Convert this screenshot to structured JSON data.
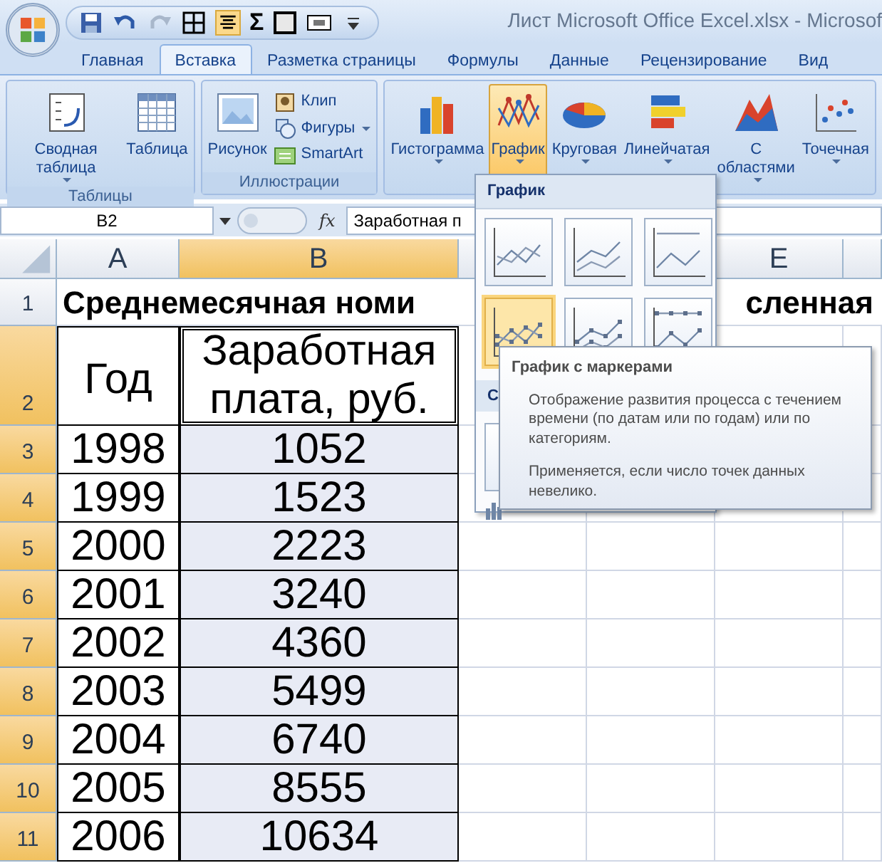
{
  "title_bar": {
    "title": "Лист Microsoft Office Excel.xlsx - Microsof",
    "sum_symbol": "Σ"
  },
  "tabs": [
    {
      "label": "Главная",
      "selected": false
    },
    {
      "label": "Вставка",
      "selected": true
    },
    {
      "label": "Разметка страницы",
      "selected": false
    },
    {
      "label": "Формулы",
      "selected": false
    },
    {
      "label": "Данные",
      "selected": false
    },
    {
      "label": "Рецензирование",
      "selected": false
    },
    {
      "label": "Вид",
      "selected": false
    }
  ],
  "ribbon": {
    "groups": [
      {
        "label": "Таблицы",
        "large": [
          {
            "kind": "pivot",
            "label": "Сводная таблица",
            "dropdown": true,
            "selected": false
          },
          {
            "kind": "table",
            "label": "Таблица",
            "dropdown": false,
            "selected": false
          }
        ]
      },
      {
        "label": "Иллюстрации",
        "large": [
          {
            "kind": "picture",
            "label": "Рисунок",
            "dropdown": false,
            "selected": false
          }
        ],
        "small": [
          {
            "kind": "clip",
            "label": "Клип",
            "dropdown": false
          },
          {
            "kind": "shapes",
            "label": "Фигуры",
            "dropdown": true
          },
          {
            "kind": "smartart",
            "label": "SmartArt",
            "dropdown": false
          }
        ]
      },
      {
        "large": [
          {
            "kind": "column",
            "label": "Гистограмма",
            "dropdown": true,
            "selected": false
          },
          {
            "kind": "line",
            "label": "График",
            "dropdown": true,
            "selected": true
          },
          {
            "kind": "pie",
            "label": "Круговая",
            "dropdown": true,
            "selected": false
          },
          {
            "kind": "bar",
            "label": "Линейчатая",
            "dropdown": true,
            "selected": false
          },
          {
            "kind": "area",
            "label": "С областями",
            "dropdown": true,
            "selected": false
          },
          {
            "kind": "scatter",
            "label": "Точечная",
            "dropdown": true,
            "selected": false
          }
        ]
      }
    ]
  },
  "formula_bar": {
    "name_box": "B2",
    "fx": "fx",
    "content": "Заработная п"
  },
  "columns": [
    {
      "label": "A",
      "selected": false
    },
    {
      "label": "B",
      "selected": true
    },
    {
      "selected": false
    },
    {},
    {
      "label": "E",
      "selected": false
    }
  ],
  "sheet": {
    "title_row": {
      "number": "1",
      "selected": false,
      "texts": [
        "Среднемесячная номи",
        "сленная"
      ]
    },
    "header_row": {
      "number": "2",
      "selected": true,
      "year": "Год",
      "wage": "Заработная плата, руб."
    },
    "rows": [
      {
        "number": "3",
        "selected": true,
        "year": "1998",
        "wage": "1052"
      },
      {
        "number": "4",
        "selected": true,
        "year": "1999",
        "wage": "1523"
      },
      {
        "number": "5",
        "selected": true,
        "year": "2000",
        "wage": "2223"
      },
      {
        "number": "6",
        "selected": true,
        "year": "2001",
        "wage": "3240"
      },
      {
        "number": "7",
        "selected": true,
        "year": "2002",
        "wage": "4360"
      },
      {
        "number": "8",
        "selected": true,
        "year": "2003",
        "wage": "5499"
      },
      {
        "number": "9",
        "selected": true,
        "year": "2004",
        "wage": "6740"
      },
      {
        "number": "10",
        "selected": true,
        "year": "2005",
        "wage": "8555"
      },
      {
        "number": "11",
        "selected": true,
        "year": "2006",
        "wage": "10634"
      }
    ]
  },
  "chart_menu": {
    "header": "График",
    "section_label": "С",
    "thumbnails": [
      {
        "selected": false
      },
      {
        "selected": false
      },
      {
        "selected": false
      },
      {
        "selected": true
      },
      {
        "selected": false
      },
      {
        "selected": false
      },
      {
        "selected": false
      }
    ],
    "tooltip": {
      "title": "График с маркерами",
      "paragraphs": [
        "Отображение развития процесса с течением времени (по датам или по годам) или по категориям.",
        "Применяется, если число точек данных невелико."
      ]
    }
  }
}
